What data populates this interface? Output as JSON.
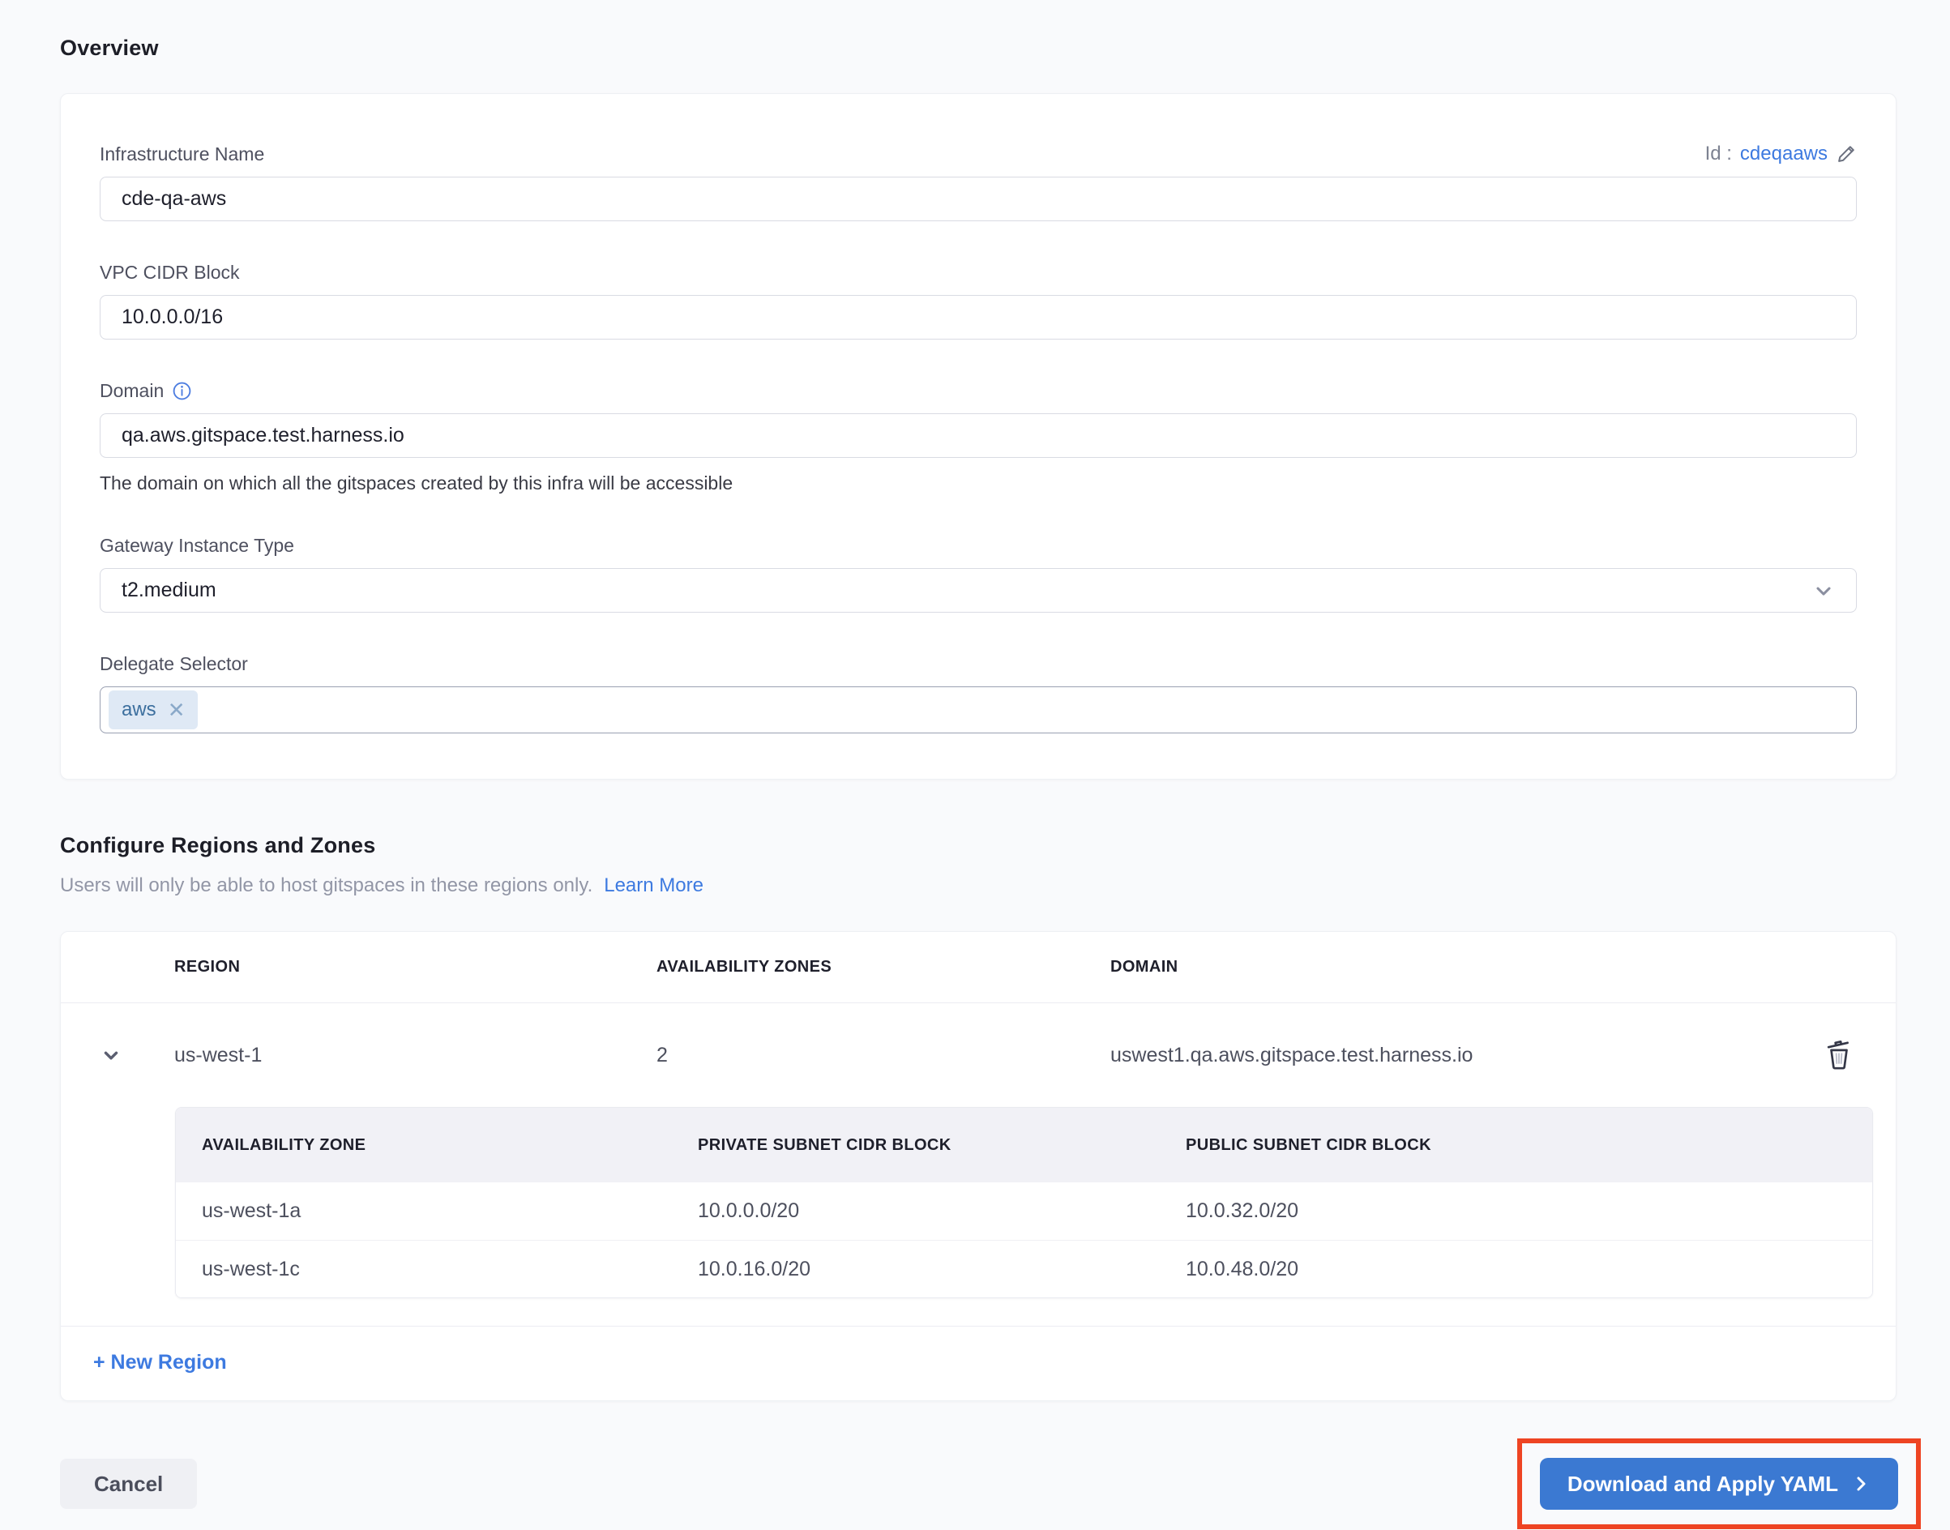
{
  "colors": {
    "page-bg": "#f9fafc",
    "accent-blue": "#3b79d2",
    "link-blue": "#3d7ae0",
    "annotation-red": "#ee4423",
    "chip-bg": "#dfe9f5",
    "chip-text": "#3c6f9e"
  },
  "overview": {
    "title": "Overview"
  },
  "form": {
    "id_label": "Id :",
    "id_value": "cdeqaaws",
    "infrastructure_name": {
      "label": "Infrastructure Name",
      "value": "cde-qa-aws"
    },
    "vpc_cidr": {
      "label": "VPC CIDR Block",
      "value": "10.0.0.0/16"
    },
    "domain": {
      "label": "Domain",
      "value": "qa.aws.gitspace.test.harness.io",
      "helper": "The domain on which all the gitspaces created by this infra will be accessible"
    },
    "gateway_instance_type": {
      "label": "Gateway Instance Type",
      "value": "t2.medium"
    },
    "delegate_selector": {
      "label": "Delegate Selector",
      "tag": "aws"
    }
  },
  "regions_section": {
    "title": "Configure Regions and Zones",
    "description": "Users will only be able to host gitspaces in these regions only.",
    "learn_more_label": "Learn More",
    "table": {
      "headers": [
        "REGION",
        "AVAILABILITY ZONES",
        "DOMAIN"
      ],
      "rows": [
        {
          "region": "us-west-1",
          "zones_count": "2",
          "domain": "uswest1.qa.aws.gitspace.test.harness.io"
        }
      ]
    },
    "zones_table": {
      "headers": [
        "AVAILABILITY ZONE",
        "PRIVATE SUBNET CIDR BLOCK",
        "PUBLIC SUBNET CIDR BLOCK"
      ],
      "rows": [
        {
          "zone": "us-west-1a",
          "private_cidr": "10.0.0.0/20",
          "public_cidr": "10.0.32.0/20"
        },
        {
          "zone": "us-west-1c",
          "private_cidr": "10.0.16.0/20",
          "public_cidr": "10.0.48.0/20"
        }
      ]
    },
    "new_region_label": "+ New Region"
  },
  "footer": {
    "cancel_label": "Cancel",
    "submit_label": "Download and Apply YAML"
  }
}
